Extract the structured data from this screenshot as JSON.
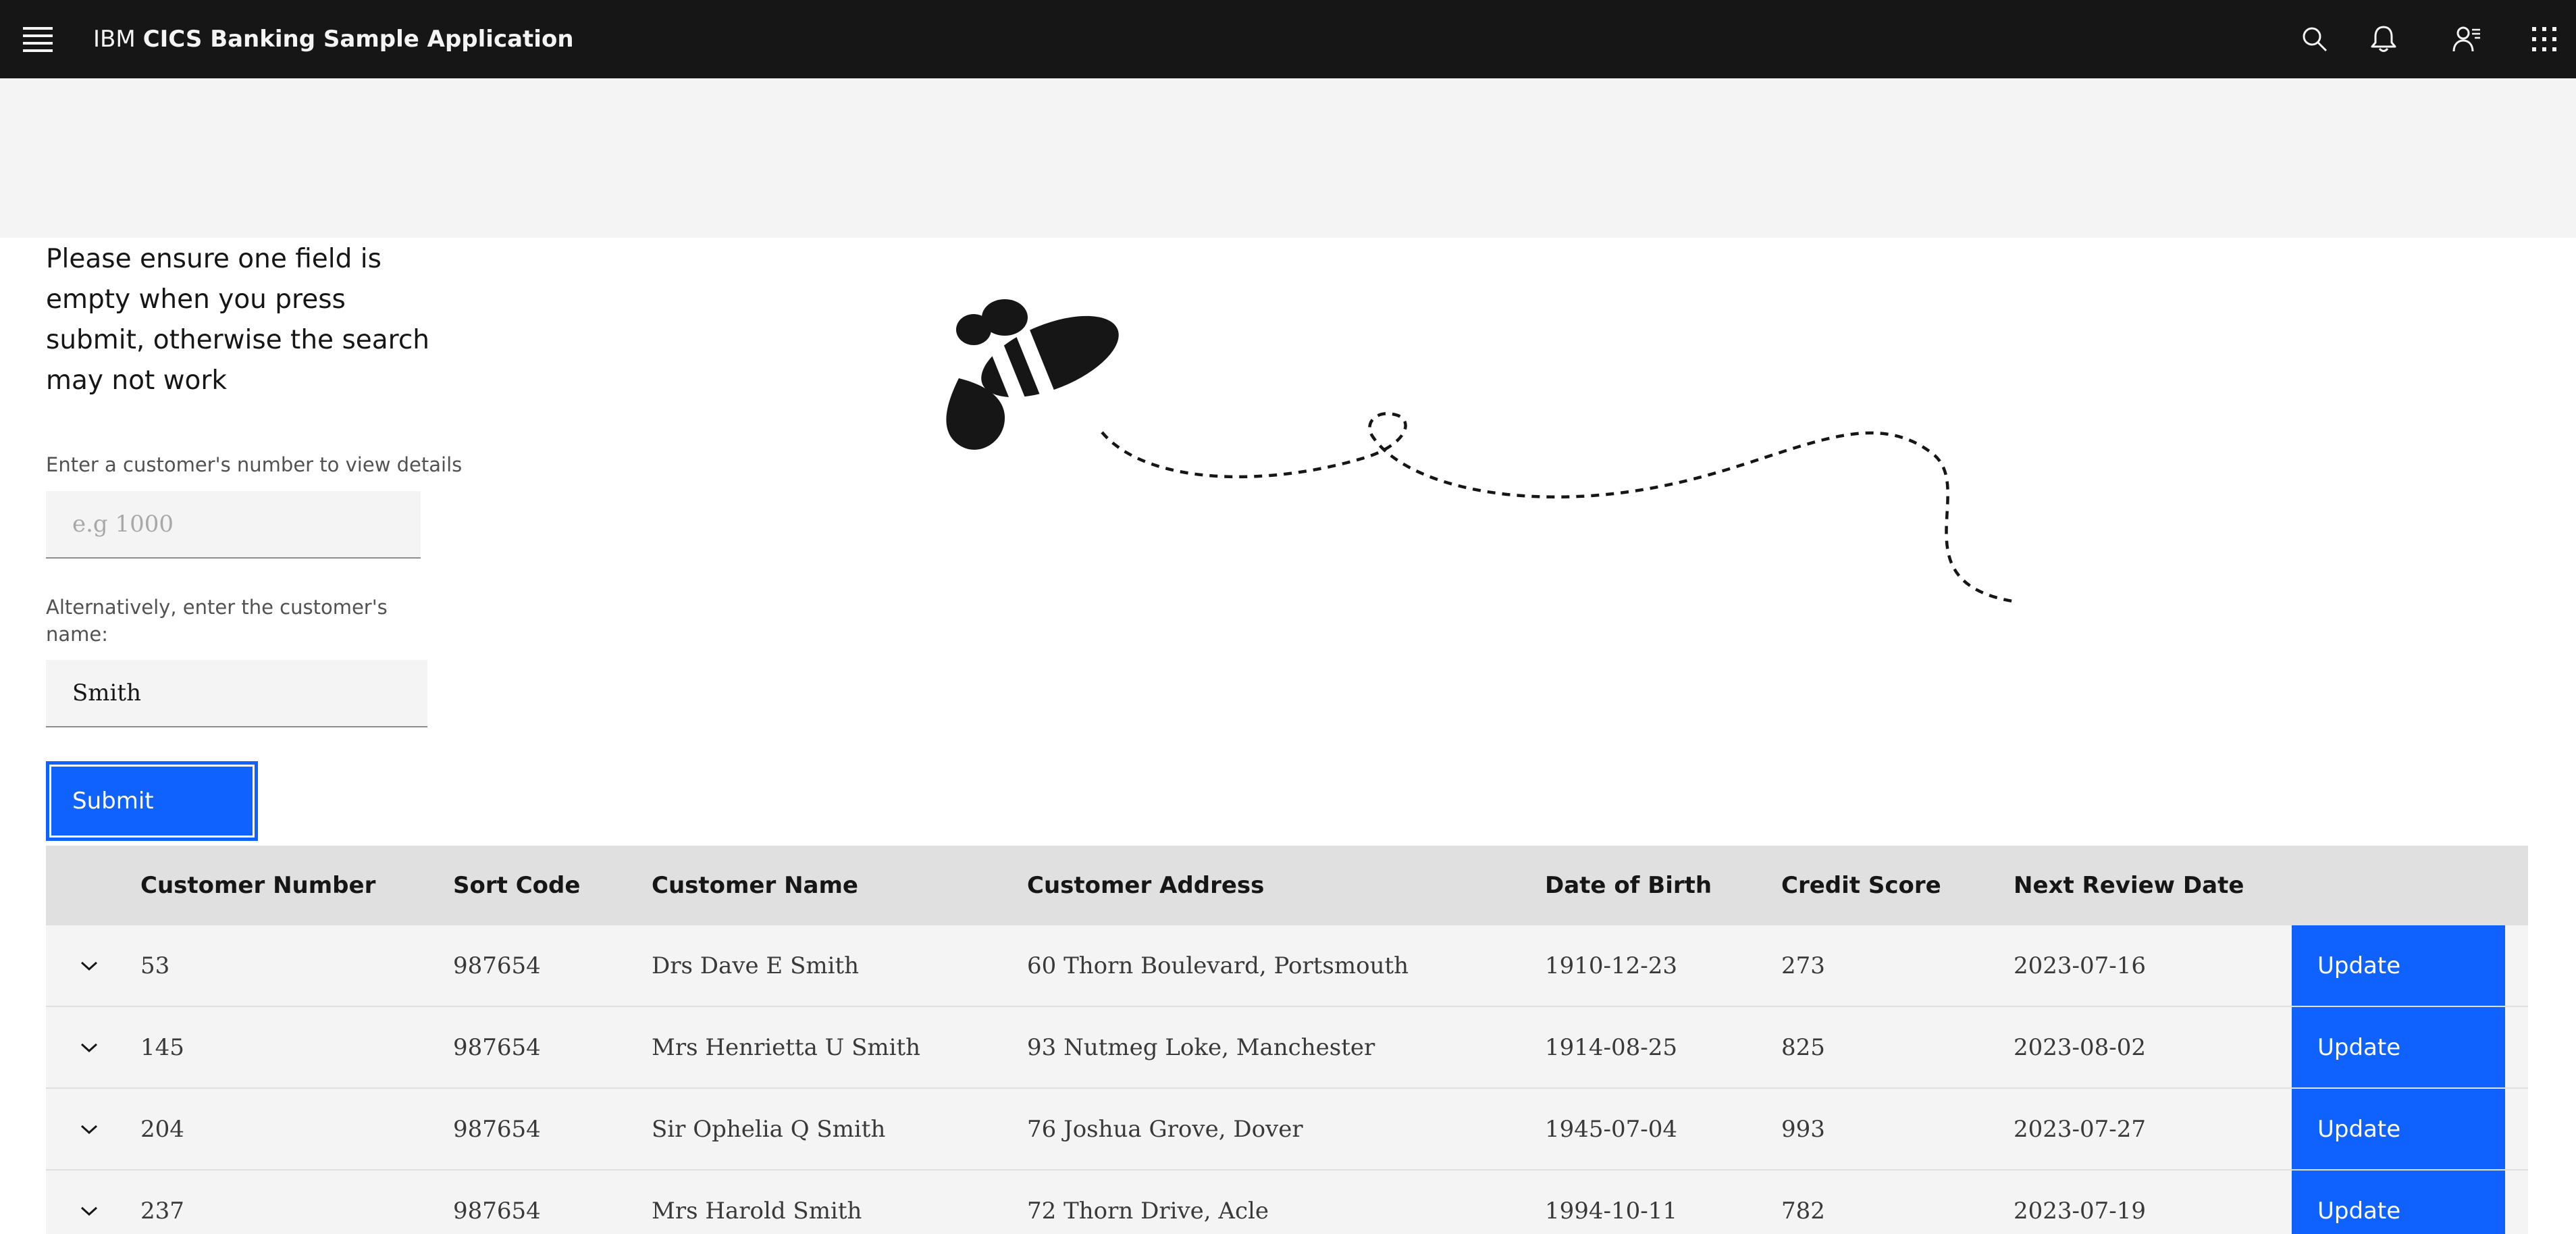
{
  "header": {
    "brand_prefix": "IBM",
    "brand_name": "CICS Banking Sample Application",
    "icons": [
      "menu-icon",
      "search-icon",
      "notification-icon",
      "user-icon",
      "app-switcher-icon"
    ]
  },
  "form": {
    "notice": "Please ensure one field is empty when you press submit, otherwise the search may not work",
    "number_label": "Enter a customer's number to view details",
    "number_placeholder": "e.g 1000",
    "number_value": "",
    "name_label": "Alternatively, enter the customer's name:",
    "name_value": "Smith",
    "submit_label": "Submit"
  },
  "table": {
    "headers": [
      "Customer Number",
      "Sort Code",
      "Customer Name",
      "Customer Address",
      "Date of Birth",
      "Credit Score",
      "Next Review Date"
    ],
    "update_label": "Update",
    "rows": [
      {
        "number": "53",
        "sort_code": "987654",
        "name": "Drs Dave E Smith",
        "address": "60 Thorn Boulevard, Portsmouth",
        "dob": "1910-12-23",
        "credit": "273",
        "review": "2023-07-16"
      },
      {
        "number": "145",
        "sort_code": "987654",
        "name": "Mrs Henrietta U Smith",
        "address": "93 Nutmeg Loke, Manchester",
        "dob": "1914-08-25",
        "credit": "825",
        "review": "2023-08-02"
      },
      {
        "number": "204",
        "sort_code": "987654",
        "name": "Sir Ophelia Q Smith",
        "address": "76 Joshua Grove, Dover",
        "dob": "1945-07-04",
        "credit": "993",
        "review": "2023-07-27"
      },
      {
        "number": "237",
        "sort_code": "987654",
        "name": "Mrs Harold Smith",
        "address": "72 Thorn Drive, Acle",
        "dob": "1994-10-11",
        "credit": "782",
        "review": "2023-07-19"
      }
    ]
  },
  "colors": {
    "header_bg": "#161616",
    "accent": "#0f62fe",
    "band_bg": "#f4f4f4",
    "table_header_bg": "#e0e0e0"
  }
}
